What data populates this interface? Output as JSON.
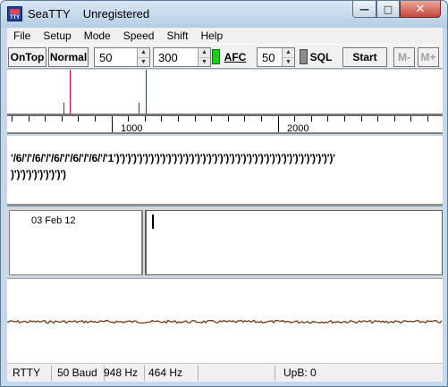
{
  "window": {
    "title": "SeaTTY",
    "registration": "Unregistered",
    "app_icon_text": "TTY"
  },
  "menu": [
    "File",
    "Setup",
    "Mode",
    "Speed",
    "Shift",
    "Help"
  ],
  "toolbar": {
    "ontop_label": "OnTop",
    "normal_label": "Normal",
    "speed_value": "50",
    "shift_value": "300",
    "afc_label": "AFC",
    "afc_led_color": "#18d018",
    "squelch_value": "50",
    "sql_label": "SQL",
    "sql_led_color": "#8c8c8c",
    "start_label": "Start",
    "mminus_label": "M-",
    "mplus_label": "M+"
  },
  "scale": {
    "labels": [
      "1000",
      "2000"
    ]
  },
  "rx_text": {
    "line1": "'/6/'/'/6/'/'/6/'/'/6/'/'/6/'/'1')')')')')')')')')')')')')')')')')')')')')')')')')')')')')')')')')')')')')')'",
    "line2": ")')')')')')')')')')"
  },
  "log": {
    "date": "03 Feb 12"
  },
  "status": {
    "mode": "RTTY",
    "baud": "50 Baud",
    "mark_freq": "948 Hz",
    "shift_freq": "464 Hz",
    "upb": "UpB: 0"
  }
}
